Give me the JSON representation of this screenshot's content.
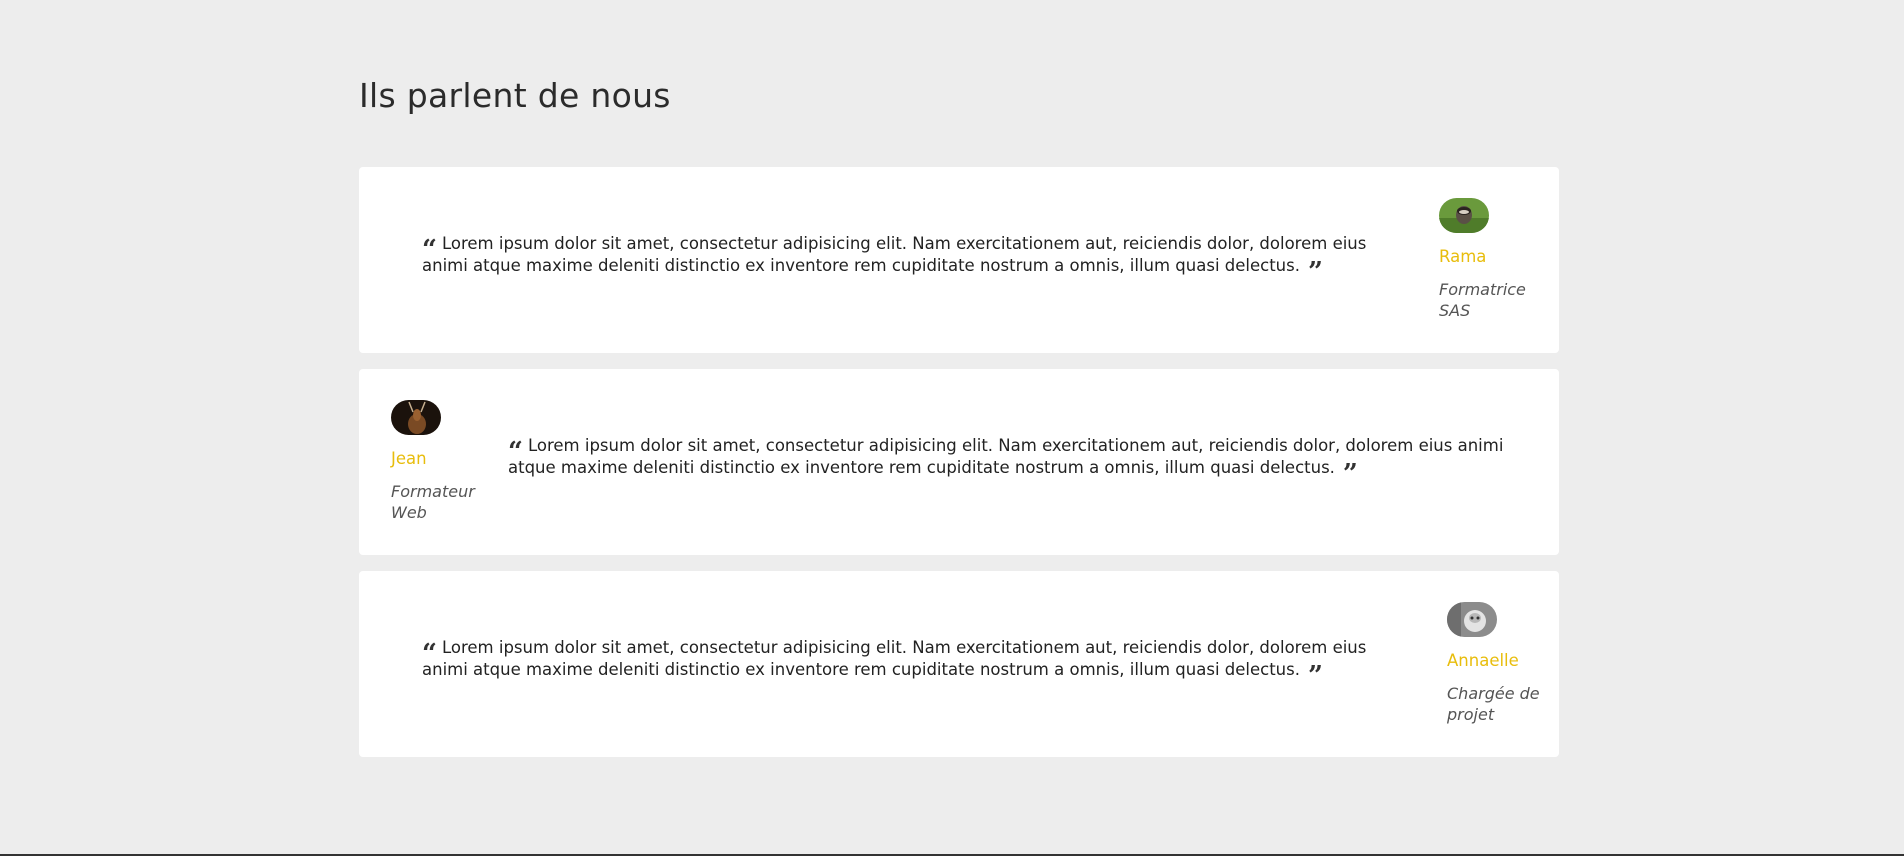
{
  "section": {
    "title": "Ils parlent de nous"
  },
  "testimonials": [
    {
      "quote": "Lorem ipsum dolor sit amet, consectetur adipisicing elit. Nam exercitationem aut, reiciendis dolor, dolorem eius animi atque maxime deleniti distinctio ex inventore rem cupiditate nostrum a omnis, illum quasi delectus.",
      "name": "Rama",
      "role": "Formatrice SAS",
      "avatar": "raccoon-photo"
    },
    {
      "quote": "Lorem ipsum dolor sit amet, consectetur adipisicing elit. Nam exercitationem aut, reiciendis dolor, dolorem eius animi atque maxime deleniti distinctio ex inventore rem cupiditate nostrum a omnis, illum quasi delectus.",
      "name": "Jean",
      "role": "Formateur Web",
      "avatar": "antelope-photo"
    },
    {
      "quote": "Lorem ipsum dolor sit amet, consectetur adipisicing elit. Nam exercitationem aut, reiciendis dolor, dolorem eius animi atque maxime deleniti distinctio ex inventore rem cupiditate nostrum a omnis, illum quasi delectus.",
      "name": "Annaelle",
      "role": "Chargée de projet",
      "avatar": "cat-photo"
    }
  ],
  "colors": {
    "background": "#ededed",
    "card": "#ffffff",
    "accent": "#e8bd0c",
    "text": "#2b2b2b"
  }
}
